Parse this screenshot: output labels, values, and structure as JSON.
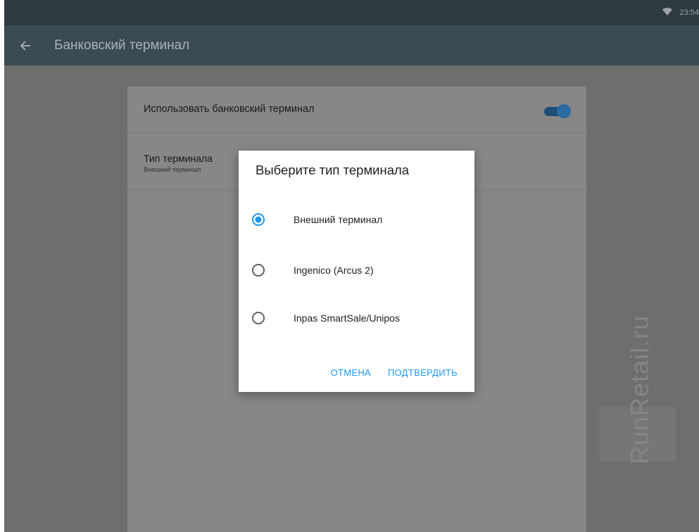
{
  "status_bar": {
    "time": "23:54",
    "wifi_icon": "wifi-icon"
  },
  "toolbar": {
    "title": "Банковский терминал",
    "back_icon": "arrow-left-icon"
  },
  "settings": {
    "use_terminal": {
      "label": "Использовать банковский терминал",
      "enabled": true
    },
    "terminal_type": {
      "title": "Тип терминала",
      "summary": "Внешний терминал"
    }
  },
  "dialog": {
    "title": "Выберите тип терминала",
    "options": [
      {
        "label": "Внешний терминал",
        "selected": true
      },
      {
        "label": "Ingenico (Arcus 2)",
        "selected": false
      },
      {
        "label": "Inpas SmartSale/Unipos",
        "selected": false
      }
    ],
    "cancel_label": "ОТМЕНА",
    "confirm_label": "ПОДТВЕРДИТЬ"
  },
  "watermark": {
    "text": "RunRetail.ru"
  },
  "colors": {
    "accent": "#2196f3",
    "toolbar": "#3b4a53",
    "statusbar": "#2e3a40",
    "scrim": "#6e6e6e"
  }
}
